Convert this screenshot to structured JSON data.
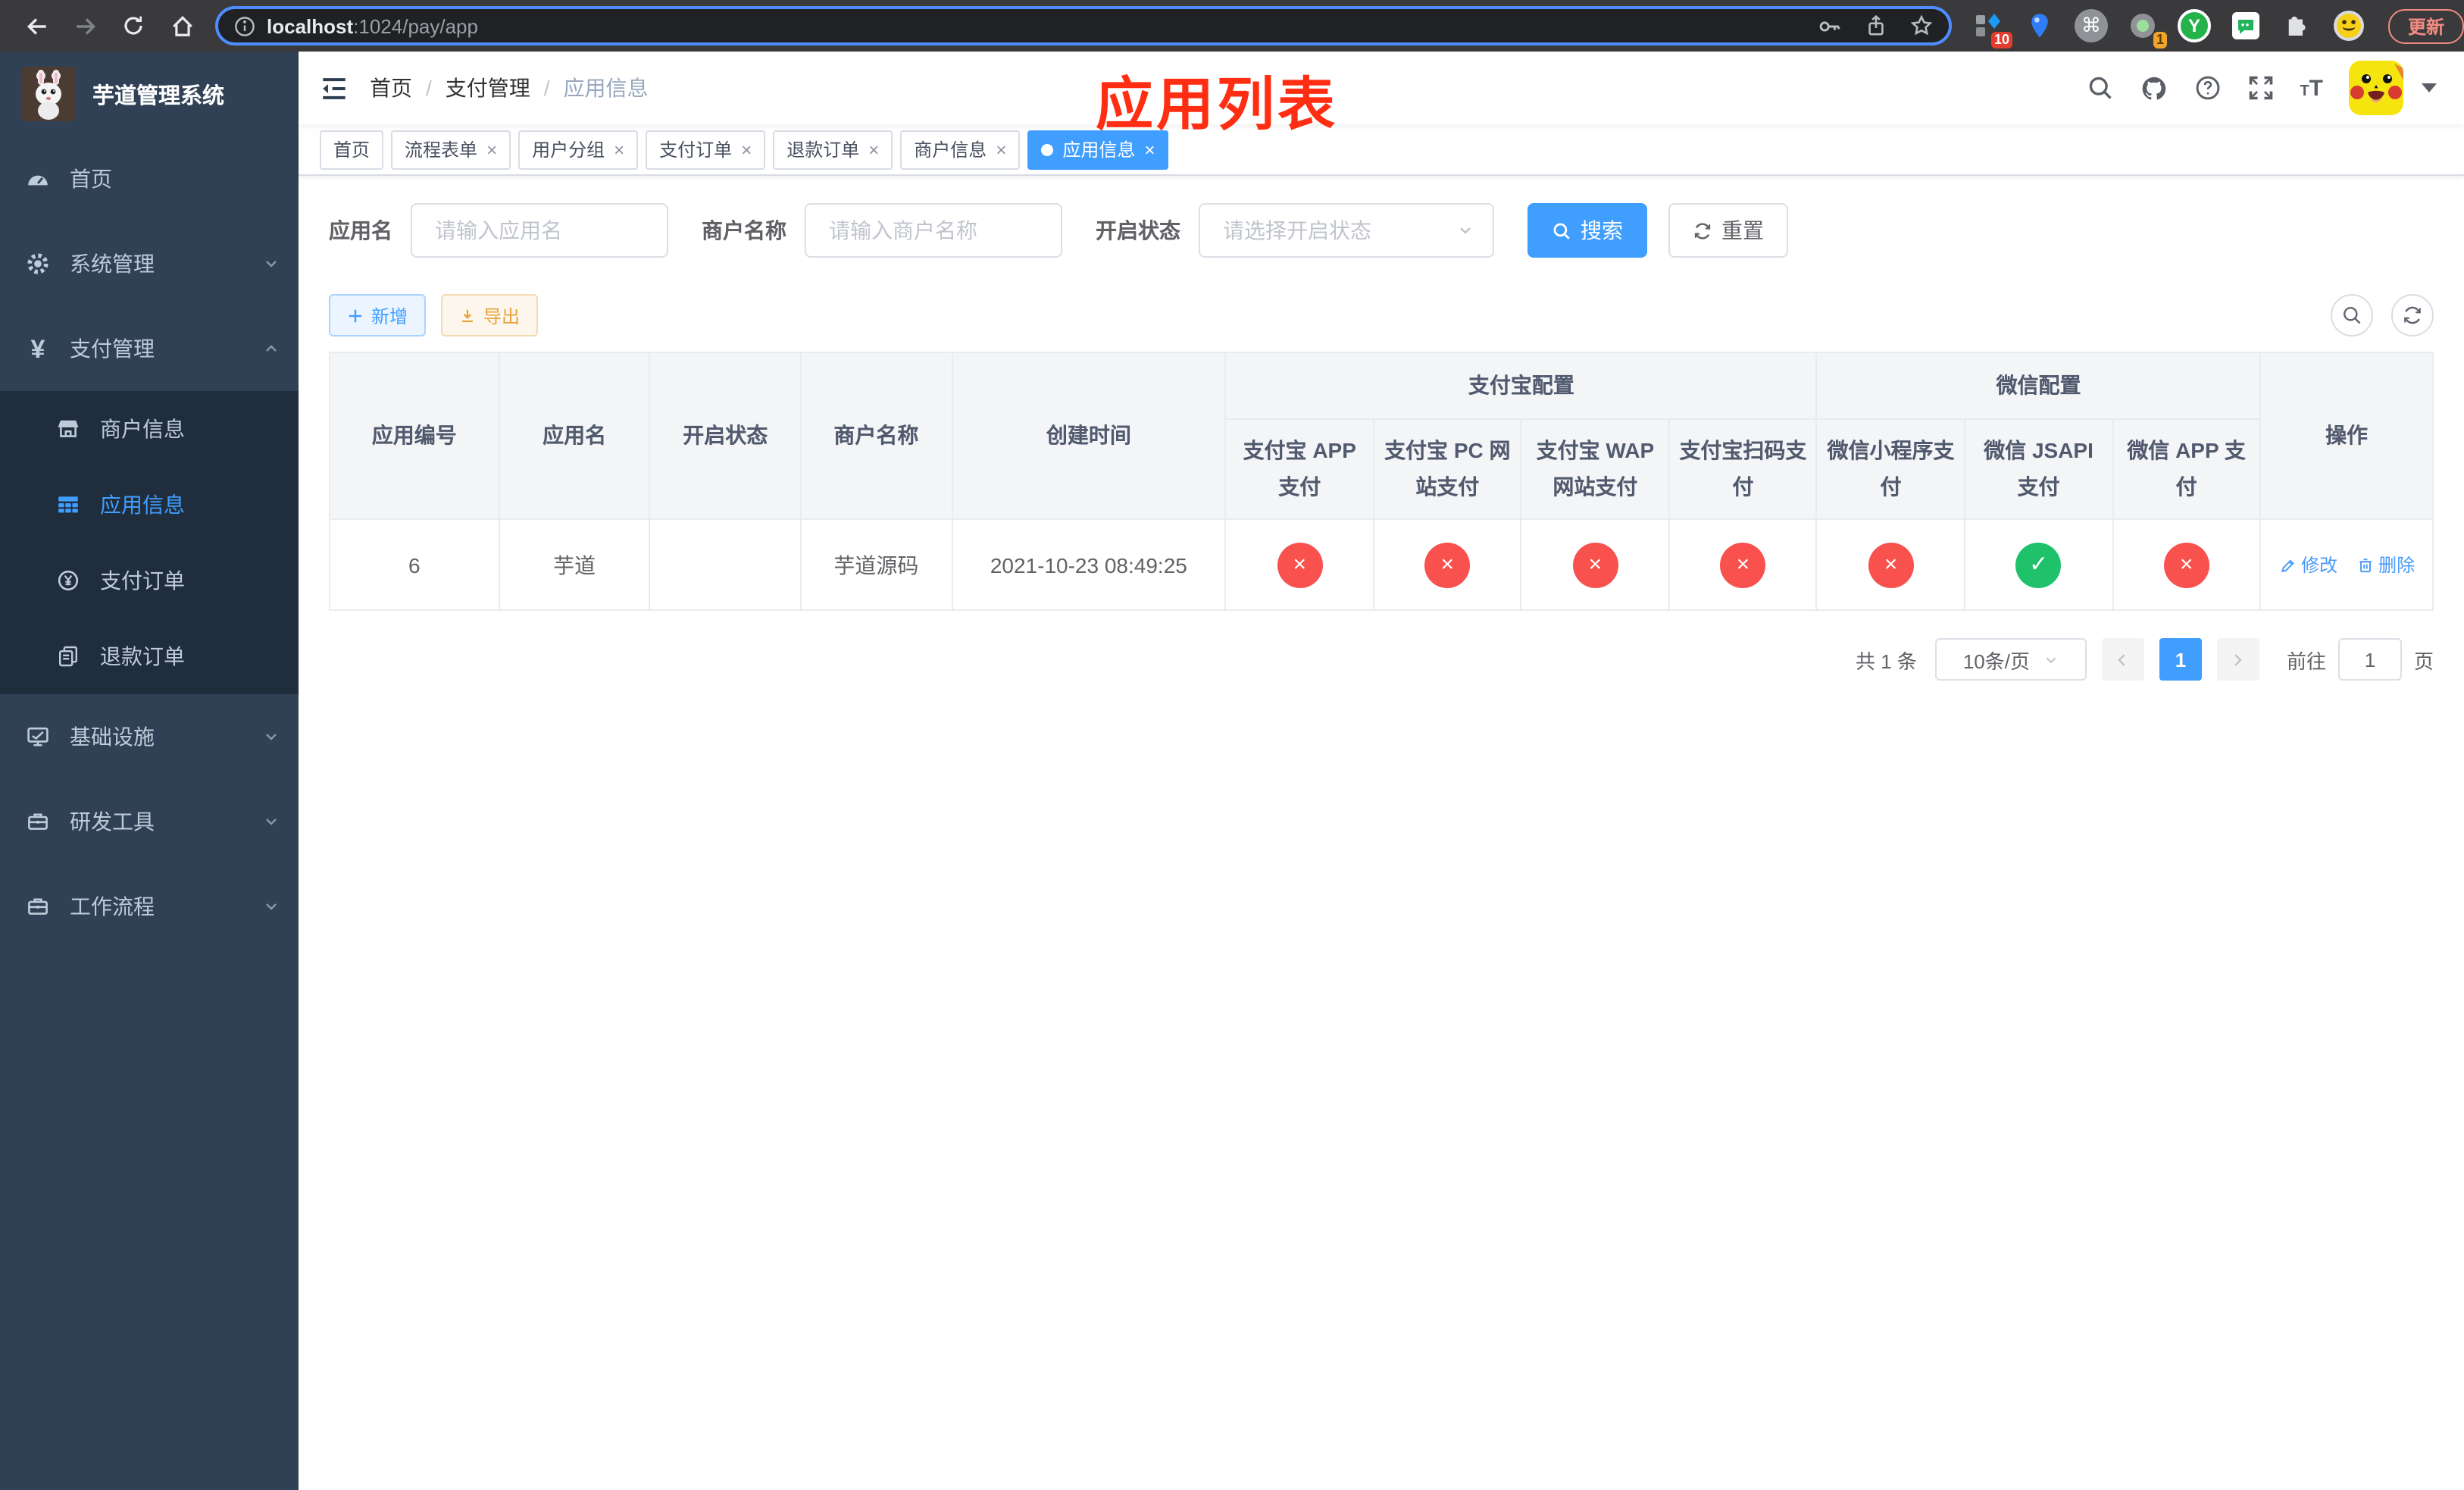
{
  "browser": {
    "url_host": "localhost",
    "url_rest": ":1024/pay/app",
    "update_label": "更新",
    "menu_dots": "⋮",
    "ext_badge_blue_diamond": "10",
    "ext_badge_record": "1",
    "ext_green_letter": "Y"
  },
  "sidebar": {
    "title": "芋道管理系统",
    "items": [
      {
        "label": "首页"
      },
      {
        "label": "系统管理"
      },
      {
        "label": "支付管理"
      },
      {
        "label": "商户信息"
      },
      {
        "label": "应用信息"
      },
      {
        "label": "支付订单"
      },
      {
        "label": "退款订单"
      },
      {
        "label": "基础设施"
      },
      {
        "label": "研发工具"
      },
      {
        "label": "工作流程"
      }
    ]
  },
  "navbar": {
    "breadcrumb": {
      "home": "首页",
      "section": "支付管理",
      "current": "应用信息"
    },
    "separator": "/"
  },
  "annotation": {
    "text": "应用列表"
  },
  "tabs": [
    {
      "label": "首页"
    },
    {
      "label": "流程表单"
    },
    {
      "label": "用户分组"
    },
    {
      "label": "支付订单"
    },
    {
      "label": "退款订单"
    },
    {
      "label": "商户信息"
    },
    {
      "label": "应用信息"
    }
  ],
  "tab_close_glyph": "×",
  "filters": {
    "app_name": {
      "label": "应用名",
      "placeholder": "请输入应用名",
      "value": ""
    },
    "merchant_name": {
      "label": "商户名称",
      "placeholder": "请输入商户名称",
      "value": ""
    },
    "status": {
      "label": "开启状态",
      "placeholder": "请选择开启状态",
      "value": ""
    },
    "search_label": "搜索",
    "reset_label": "重置"
  },
  "toolbar": {
    "add_label": "新增",
    "export_label": "导出"
  },
  "table": {
    "plain_columns": [
      "应用编号",
      "应用名",
      "开启状态",
      "商户名称",
      "创建时间"
    ],
    "group_alipay": {
      "label": "支付宝配置",
      "children": [
        "支付宝 APP 支付",
        "支付宝 PC 网站支付",
        "支付宝 WAP 网站支付",
        "支付宝扫码支付"
      ]
    },
    "group_wechat": {
      "label": "微信配置",
      "children": [
        "微信小程序支付",
        "微信 JSAPI 支付",
        "微信 APP 支付"
      ]
    },
    "actions_column": "操作",
    "row": {
      "id": "6",
      "name": "芋道",
      "enabled": true,
      "merchant": "芋道源码",
      "created_at": "2021-10-23 08:49:25",
      "statuses": [
        "no",
        "no",
        "no",
        "no",
        "no",
        "yes",
        "no"
      ],
      "edit_label": "修改",
      "delete_label": "删除"
    }
  },
  "pagination": {
    "total": "共 1 条",
    "page_size": "10条/页",
    "page": "1",
    "goto_label": "前往",
    "goto_value": "1",
    "goto_unit": "页"
  },
  "colors": {
    "primary": "#409eff",
    "success": "#1fc26a",
    "danger": "#f8514e",
    "warning": "#e6a23c",
    "annotation": "#ff2d12"
  }
}
